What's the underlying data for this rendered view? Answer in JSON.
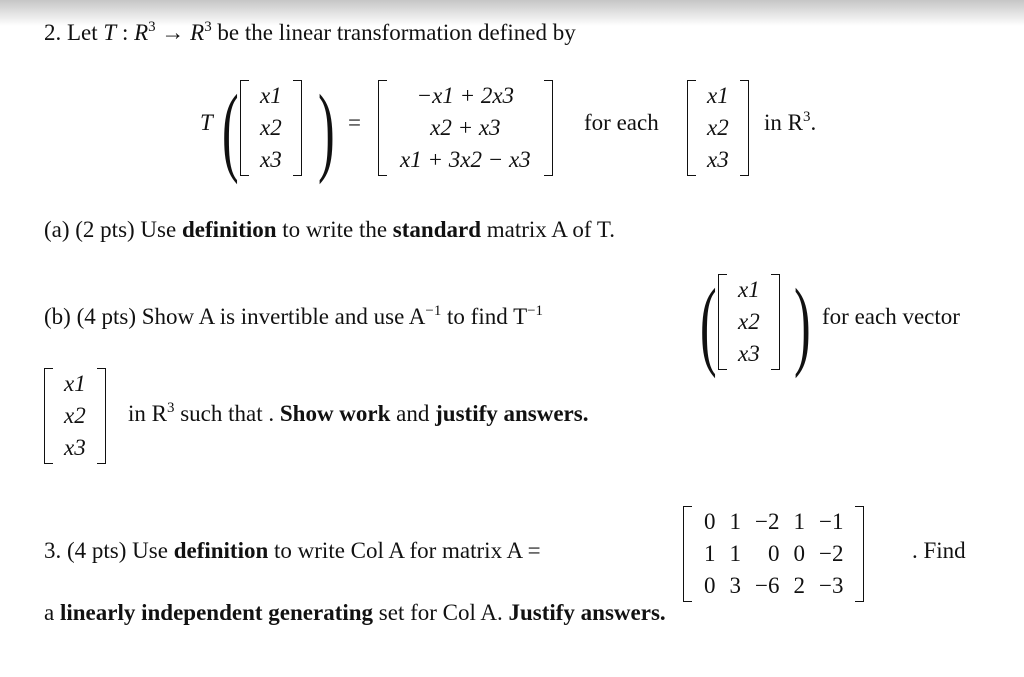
{
  "problem2": {
    "number": "2.",
    "intro_pre": "Let",
    "T": "T",
    "colon": ":",
    "domain": "R",
    "domain_exp": "3",
    "arrow": "→",
    "codomain": "R",
    "codomain_exp": "3",
    "intro_post": "be the linear transformation defined by",
    "definition": {
      "input_vector": [
        "x1",
        "x2",
        "x3"
      ],
      "output_vector": [
        "−x1 + 2x3",
        "x2 + x3",
        "x1 + 3x2 − x3"
      ],
      "equals": "=",
      "for_each": "for each",
      "in_space": "in R",
      "in_space_exp": "3",
      "period": "."
    },
    "part_a": {
      "label": "(a) (2 pts) Use",
      "bold1": "definition",
      "mid": "to write the",
      "bold2": "standard",
      "post": "matrix A of T."
    },
    "part_b": {
      "label": "(b) (4 pts) Show A is invertible and use A",
      "inv_exp": "−1",
      "mid": "to find T",
      "tail": "for each vector",
      "line2_pre": "in R",
      "line2_exp": "3",
      "line2_mid": "such that .",
      "bold1": "Show work",
      "and": "and",
      "bold2": "justify answers."
    }
  },
  "problem3": {
    "label": "3. (4 pts) Use",
    "bold1": "definition",
    "mid": "to write Col A for matrix A =",
    "matrix": [
      [
        "0",
        "1",
        "−2",
        "1",
        "−1"
      ],
      [
        "1",
        "1",
        "0",
        "0",
        "−2"
      ],
      [
        "0",
        "3",
        "−6",
        "2",
        "−3"
      ]
    ],
    "after_matrix": ". Find",
    "line2_pre": "a",
    "bold2": "linearly independent generating",
    "line2_mid": "set for Col A.",
    "bold3": "Justify answers."
  }
}
